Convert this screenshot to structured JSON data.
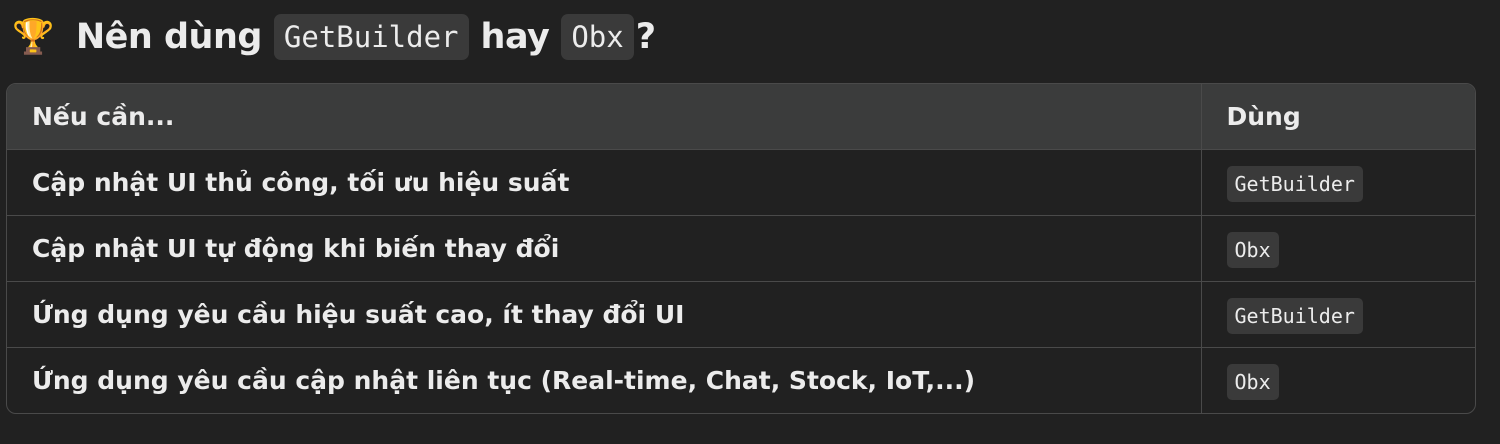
{
  "heading": {
    "icon": "trophy-icon",
    "text_before": "Nên dùng",
    "code_1": "GetBuilder",
    "text_middle": "hay",
    "code_2": "Obx",
    "text_after": "?"
  },
  "table": {
    "columns": [
      "Nếu cần...",
      "Dùng"
    ],
    "rows": [
      {
        "need": "Cập nhật UI thủ công, tối ưu hiệu suất",
        "use": "GetBuilder"
      },
      {
        "need": "Cập nhật UI tự động khi biến thay đổi",
        "use": "Obx"
      },
      {
        "need": "Ứng dụng yêu cầu hiệu suất cao, ít thay đổi UI",
        "use": "GetBuilder"
      },
      {
        "need": "Ứng dụng yêu cầu cập nhật liên tục (Real-time, Chat, Stock, IoT,...)",
        "use": "Obx"
      }
    ]
  },
  "colors": {
    "background": "#212121",
    "header_background": "#3b3c3c",
    "code_background": "#3a3a3a",
    "border": "#4a4a4a",
    "text": "#ececec"
  }
}
